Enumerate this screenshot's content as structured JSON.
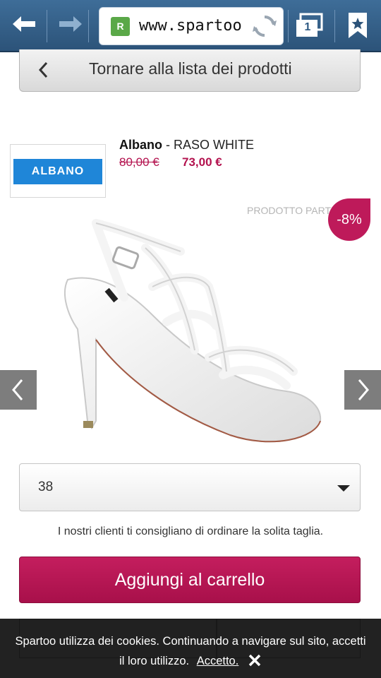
{
  "browser": {
    "url": "www.spartoo.it",
    "tab_count": "1",
    "site_icon_letter": "R"
  },
  "back_to_list": {
    "label": "Tornare alla lista dei prodotti"
  },
  "product": {
    "brand_logo_text": "ALBANO",
    "brand": "Albano",
    "separator": " - ",
    "name": "RASO WHITE",
    "old_price": "80,00 €",
    "new_price": "73,00 €",
    "partner_label": "PRODOTTO PARTNER",
    "discount": "-8%"
  },
  "size_select": {
    "value": "38"
  },
  "advice_text": "I nostri clienti ti consigliano di ordinare la solita taglia.",
  "cart_button": {
    "label": "Aggiungi al carrello"
  },
  "cookie_banner": {
    "text_line1": "Spartoo utilizza dei cookies. Continuando a navigare sul sito, accetti",
    "text_line2": "il loro utilizzo.",
    "accept_label": "Accetto."
  },
  "colors": {
    "accent": "#be1a5a",
    "toolbar": "#2c5379",
    "site_icon": "#5aa848"
  }
}
